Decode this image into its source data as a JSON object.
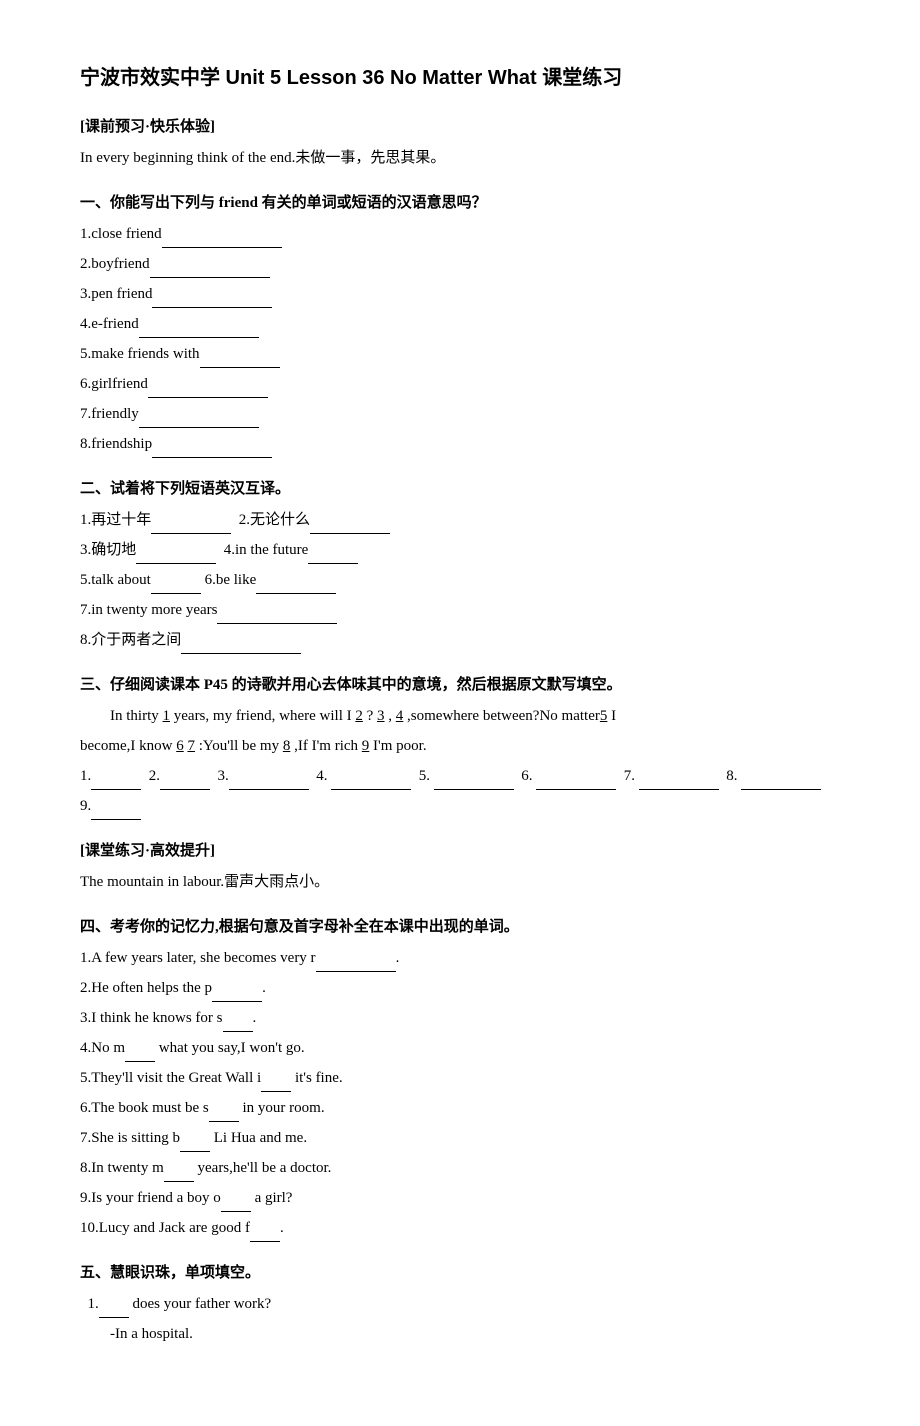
{
  "title": "宁波市效实中学 Unit 5 Lesson 36 No Matter What 课堂练习",
  "section_preview_header": "[课前预习·快乐体验]",
  "section_preview_quote": "In every beginning think of the end.未做一事，先思其果。",
  "part1_header": "一、你能写出下列与 friend 有关的单词或短语的汉语意思吗？",
  "part1_items": [
    "1.close friend",
    "2.boyfriend",
    "3.pen friend",
    "4.e-friend",
    "5.make friends with",
    "6.girlfriend",
    "7.friendly",
    "8.friendship"
  ],
  "part2_header": "二、试着将下列短语英汉互译。",
  "part2_items": [
    {
      "zh": "1.再过十年",
      "en": "2.无论什么"
    },
    {
      "zh": "3.确切地",
      "en": "4.in the future"
    },
    {
      "zh": "5.talk about",
      "en": "6.be like"
    },
    {
      "zh": "7.in twenty more years"
    },
    {
      "zh": "8.介于两者之间"
    }
  ],
  "part3_header": "三、仔细阅读课本 P45 的诗歌并用心去体味其中的意境，然后根据原文默写填空。",
  "part3_poem": "In thirty _1_ years, my friend, where will I _2_ ? _3_ , _4_ ,somewhere between?No matter_5_ I become,I know _6_ _7_ :You'll be my _8_ ,If I'm rich _9_ I'm poor.",
  "part3_blanks": [
    "1.______",
    "2.______",
    "3.________",
    "4. ________",
    "5. ________",
    "6. ________",
    "7. ________",
    "8. ________"
  ],
  "part3_blank9": "9.______",
  "section_class_header": "[课堂练习·高效提升]",
  "section_class_quote": "The mountain in labour.雷声大雨点小。",
  "part4_header": "四、考考你的记忆力,根据句意及首字母补全在本课中出现的单词。",
  "part4_items": [
    "1.A few years later, she becomes very r______.",
    "2.He often helps the p______.",
    "3.I think he knows for s____.",
    "4.No m____ what you say,I won't go.",
    "5.They'll visit the Great Wall i____ it's fine.",
    "6.The book must be s____ in your room.",
    "7.She is sitting b____ Li Hua and me.",
    "8.In twenty m____ years,he'll be a doctor.",
    "9.Is your friend a boy o___ a girl?",
    "10.Lucy and Jack are good f____."
  ],
  "part5_header": "五、慧眼识珠，单项填空。",
  "part5_item1_q": "1.___ does your father work?",
  "part5_item1_a": "-In a hospital."
}
